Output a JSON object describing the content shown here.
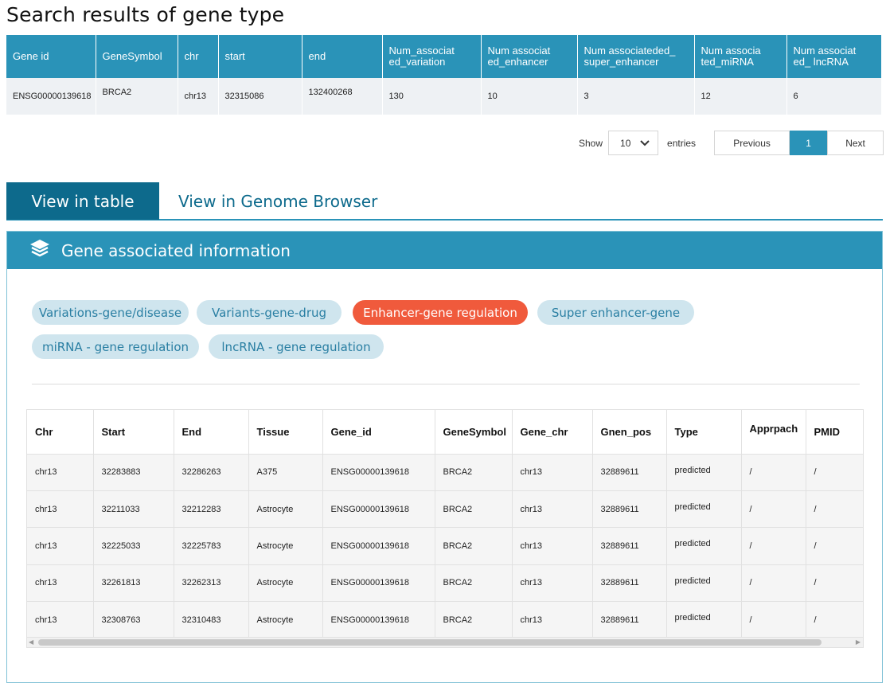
{
  "page_title": "Search results of gene  type",
  "results": {
    "headers": [
      "Gene id",
      "GeneSymbol",
      "chr",
      "start",
      "end",
      "Num_associat ed_variation",
      "Num associat ed_enhancer",
      "Num associateded_ super_enhancer",
      "Num associa ted_miRNA",
      "Num associat ed_ lncRNA"
    ],
    "rows": [
      [
        "ENSG00000139618",
        "BRCA2",
        "chr13",
        "32315086",
        "132400268",
        "130",
        "10",
        "3",
        "12",
        "6"
      ]
    ]
  },
  "pagination": {
    "show_label": "Show",
    "entries_value": "10",
    "entries_label": "entries",
    "previous": "Previous",
    "current": "1",
    "next": "Next"
  },
  "view_tabs": {
    "table": "View in table",
    "genome": "View in Genome Browser"
  },
  "panel": {
    "title": "Gene associated information",
    "pills": [
      "Variations-gene/disease",
      "Variants-gene-drug",
      "Enhancer-gene regulation",
      "Super enhancer-gene",
      "miRNA - gene regulation",
      "lncRNA - gene regulation"
    ],
    "active_pill": "Enhancer-gene regulation",
    "accent_color": "#2a93b8",
    "active_color": "#f05a3c"
  },
  "enhancer_table": {
    "headers": [
      "Chr",
      "Start",
      "End",
      "Tissue",
      "Gene_id",
      "GeneSymbol",
      "Gene_chr",
      "Gnen_pos",
      "Type",
      "Apprpach",
      "PMID"
    ],
    "rows": [
      [
        "chr13",
        "32283883",
        "32286263",
        "A375",
        "ENSG00000139618",
        "BRCA2",
        "chr13",
        "32889611",
        "predicted",
        "/",
        "/"
      ],
      [
        "chr13",
        "32211033",
        "32212283",
        "Astrocyte",
        "ENSG00000139618",
        "BRCA2",
        "chr13",
        "32889611",
        "predicted",
        "/",
        "/"
      ],
      [
        "chr13",
        "32225033",
        "32225783",
        "Astrocyte",
        "ENSG00000139618",
        "BRCA2",
        "chr13",
        "32889611",
        "predicted",
        "/",
        "/"
      ],
      [
        "chr13",
        "32261813",
        "32262313",
        "Astrocyte",
        "ENSG00000139618",
        "BRCA2",
        "chr13",
        "32889611",
        "predicted",
        "/",
        "/"
      ],
      [
        "chr13",
        "32308763",
        "32310483",
        "Astrocyte",
        "ENSG00000139618",
        "BRCA2",
        "chr13",
        "32889611",
        "predicted",
        "/",
        "/"
      ]
    ]
  }
}
